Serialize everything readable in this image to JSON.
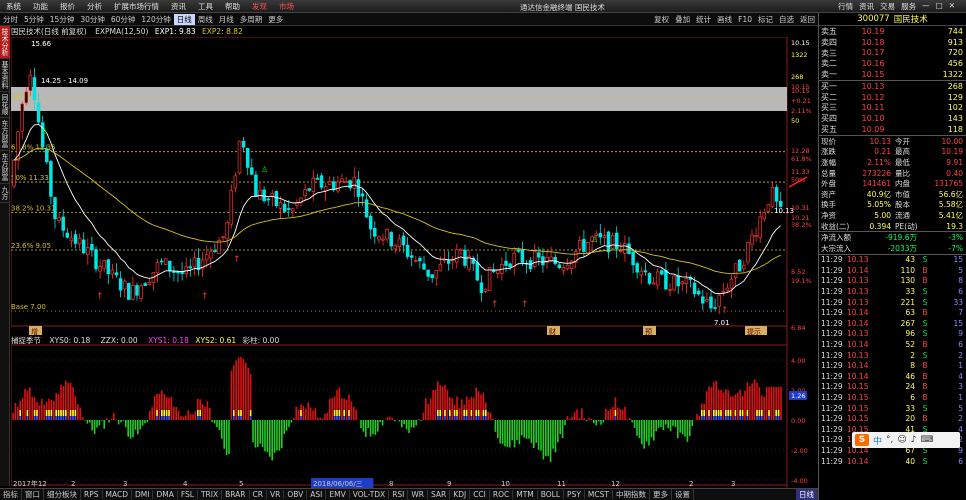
{
  "menubar": {
    "items": [
      "系统",
      "功能",
      "报价",
      "分析",
      "扩展市场行情",
      "资讯",
      "工具",
      "帮助"
    ],
    "highlight": [
      "发现",
      "市场"
    ],
    "app_title": "通达信金融终端 国民技术",
    "right_items": [
      "行情",
      "资讯",
      "交易",
      "服务"
    ]
  },
  "toolbar": {
    "periods": [
      "分时",
      "5分钟",
      "15分钟",
      "30分钟",
      "60分钟",
      "120分钟",
      "日线",
      "周线",
      "月线",
      "多周期",
      "更多"
    ],
    "active_period": "日线",
    "right_items": [
      "复权",
      "叠加",
      "统计",
      "画线",
      "F10",
      "标记",
      "自选",
      "返回"
    ]
  },
  "left_tabs": [
    "技术分析",
    "基本资料",
    "同花顺",
    "东方财富",
    "东方财富",
    "九方"
  ],
  "kline": {
    "title": "国民技术(日线 前复权)",
    "ma_label": "EXPMA(12,50)",
    "exp1": "EXP1: 9.83",
    "exp2": "EXP2: 8.82",
    "high_label": "15.66",
    "annot_high": "14.25 - 14.09",
    "fib_labels": [
      "61.8% 12.35",
      "50% 11.33",
      "38.2% 10.31",
      "23.6% 9.05"
    ],
    "fib_top": "14.09",
    "base_label": "Base 7.00",
    "low_label": "7.01",
    "cur_label": "10.13",
    "event_labels": [
      "增",
      "财",
      "预",
      "提示"
    ]
  },
  "price_axis": {
    "ticks": [
      "10.15",
      "1322",
      "10.15",
      "268",
      "10.15",
      "+0.21",
      "2.11%",
      "50",
      "12.28",
      "61.8%",
      "11.33",
      "50%",
      "10.31",
      "10.21",
      "38.2%",
      "8.52",
      "19.1%",
      "6.84"
    ]
  },
  "indicator": {
    "name": "捕捉季节",
    "xys0": "XYS0: 0.18",
    "zzx": "ZZX: 0.00",
    "xys1": "XYS1: 0.18",
    "xys2": "XYS2: 0.61",
    "caizhu": "彩柱: 0.00",
    "ticks": [
      "4.00",
      "2.00",
      "0.00",
      "-2.00",
      "-4.00"
    ],
    "cur": "1.26"
  },
  "date_axis": {
    "labels": [
      "2017年12",
      "2",
      "3",
      "4",
      "5",
      "2018/06/06/三",
      "8",
      "9",
      "10",
      "11",
      "12",
      "2",
      "3"
    ]
  },
  "bottom_tabs": [
    "指标",
    "窗口",
    "细分板块",
    "RPS",
    "MACD",
    "DMI",
    "DMA",
    "FSL",
    "TRIX",
    "BRAR",
    "CR",
    "VR",
    "OBV",
    "ASI",
    "EMV",
    "VOL-TDX",
    "RSI",
    "WR",
    "SAR",
    "KDJ",
    "CCI",
    "ROC",
    "MTM",
    "BOLL",
    "PSY",
    "MCST",
    "中期指数",
    "更多",
    "设置"
  ],
  "bottom_right": "日线",
  "panel": {
    "code": "300077",
    "name": "国民技术",
    "sells": [
      [
        "卖五",
        "10.19",
        "744"
      ],
      [
        "卖四",
        "10.18",
        "913"
      ],
      [
        "卖三",
        "10.17",
        "720"
      ],
      [
        "卖二",
        "10.16",
        "456"
      ],
      [
        "卖一",
        "10.15",
        "1322"
      ]
    ],
    "buys": [
      [
        "买一",
        "10.13",
        "268"
      ],
      [
        "买二",
        "10.12",
        "129"
      ],
      [
        "买三",
        "10.11",
        "102"
      ],
      [
        "买四",
        "10.10",
        "143"
      ],
      [
        "买五",
        "10.09",
        "118"
      ]
    ],
    "stats": [
      [
        "现价",
        "10.13",
        "今开",
        "10.00"
      ],
      [
        "涨跌",
        "0.21",
        "最高",
        "10.19"
      ],
      [
        "涨幅",
        "2.11%",
        "最低",
        "9.91"
      ],
      [
        "总量",
        "273226",
        "量比",
        "0.40"
      ],
      [
        "外盘",
        "141461",
        "内盘",
        "131765"
      ],
      [
        "资产",
        "40.9亿",
        "市值",
        "56.6亿"
      ],
      [
        "换手",
        "5.05%",
        "股本",
        "5.58亿"
      ],
      [
        "净资",
        "5.00",
        "流通",
        "5.41亿"
      ],
      [
        "收益(二)",
        "0.394",
        "PE(动)",
        "19.3"
      ]
    ],
    "flows": [
      [
        "净流入额",
        "-919.6万",
        "-3%"
      ],
      [
        "大宗流入",
        "-2033万",
        "-7%"
      ]
    ],
    "ticks": [
      [
        "11:29",
        "10.13",
        "43",
        "S",
        "15"
      ],
      [
        "11:29",
        "10.14",
        "110",
        "B",
        "5"
      ],
      [
        "11:29",
        "10.13",
        "130",
        "B",
        "8"
      ],
      [
        "11:29",
        "10.13",
        "33",
        "S",
        "6"
      ],
      [
        "11:29",
        "10.13",
        "221",
        "S",
        "33"
      ],
      [
        "11:29",
        "10.14",
        "63",
        "B",
        "7"
      ],
      [
        "11:29",
        "10.14",
        "267",
        "S",
        "15"
      ],
      [
        "11:29",
        "10.13",
        "96",
        "S",
        "9"
      ],
      [
        "11:29",
        "10.14",
        "52",
        "B",
        "6"
      ],
      [
        "11:29",
        "10.13",
        "2",
        "S",
        "2"
      ],
      [
        "11:29",
        "10.14",
        "8",
        "B",
        "1"
      ],
      [
        "11:29",
        "10.14",
        "46",
        "B",
        "4"
      ],
      [
        "11:29",
        "10.15",
        "24",
        "B",
        "3"
      ],
      [
        "11:29",
        "10.15",
        "6",
        "B",
        "1"
      ],
      [
        "11:29",
        "10.15",
        "33",
        "S",
        "5"
      ],
      [
        "11:29",
        "10.15",
        "20",
        "B",
        "2"
      ],
      [
        "11:29",
        "10.15",
        "41",
        "S",
        "4"
      ],
      [
        "11:29",
        "10.14",
        "19",
        "S",
        "2"
      ],
      [
        "11:29",
        "10.14",
        "67",
        "S",
        "9"
      ],
      [
        "11:29",
        "10.14",
        "40",
        "S",
        "6"
      ]
    ]
  },
  "colors": {
    "up": "#ff3232",
    "down": "#00e5e5",
    "ma1": "#ffffff",
    "ma2": "#d4c020",
    "fib": "#d4c020",
    "band": "#b8b8b8"
  },
  "icons": [
    "sogou-ime-icon",
    "close-icon",
    "minimize-icon",
    "maximize-icon"
  ]
}
